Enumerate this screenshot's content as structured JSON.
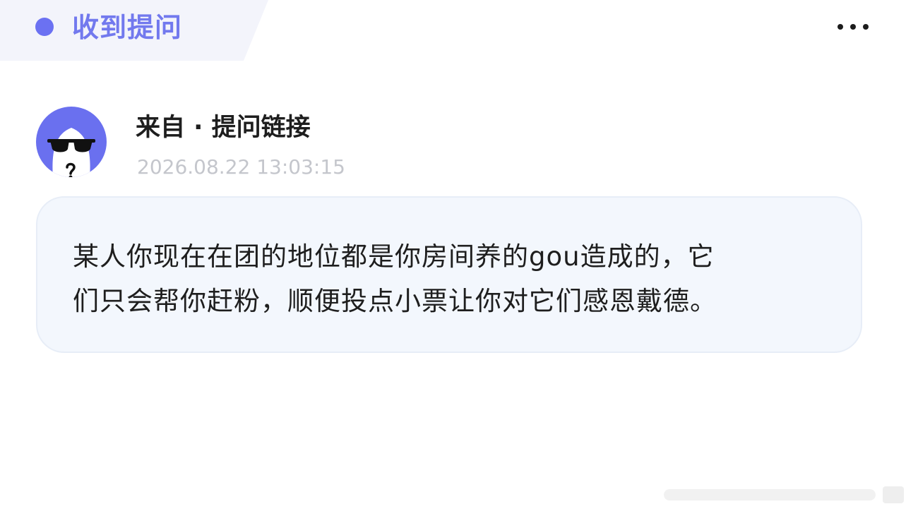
{
  "header": {
    "tab_title": "收到提问",
    "accent_color": "#6b71f2",
    "more_icon": "more-horizontal-icon"
  },
  "question": {
    "sender_label": "来自 · 提问链接",
    "timestamp": "2026.08.22 13:03:15",
    "avatar_icon": "anonymous-sunglasses-avatar",
    "body_line_1": "某人你现在在团的地位都是你房间养的gou造成的，它",
    "body_line_2": "们只会帮你赶粉，顺便投点小票让你对它们感恩戴德。"
  }
}
